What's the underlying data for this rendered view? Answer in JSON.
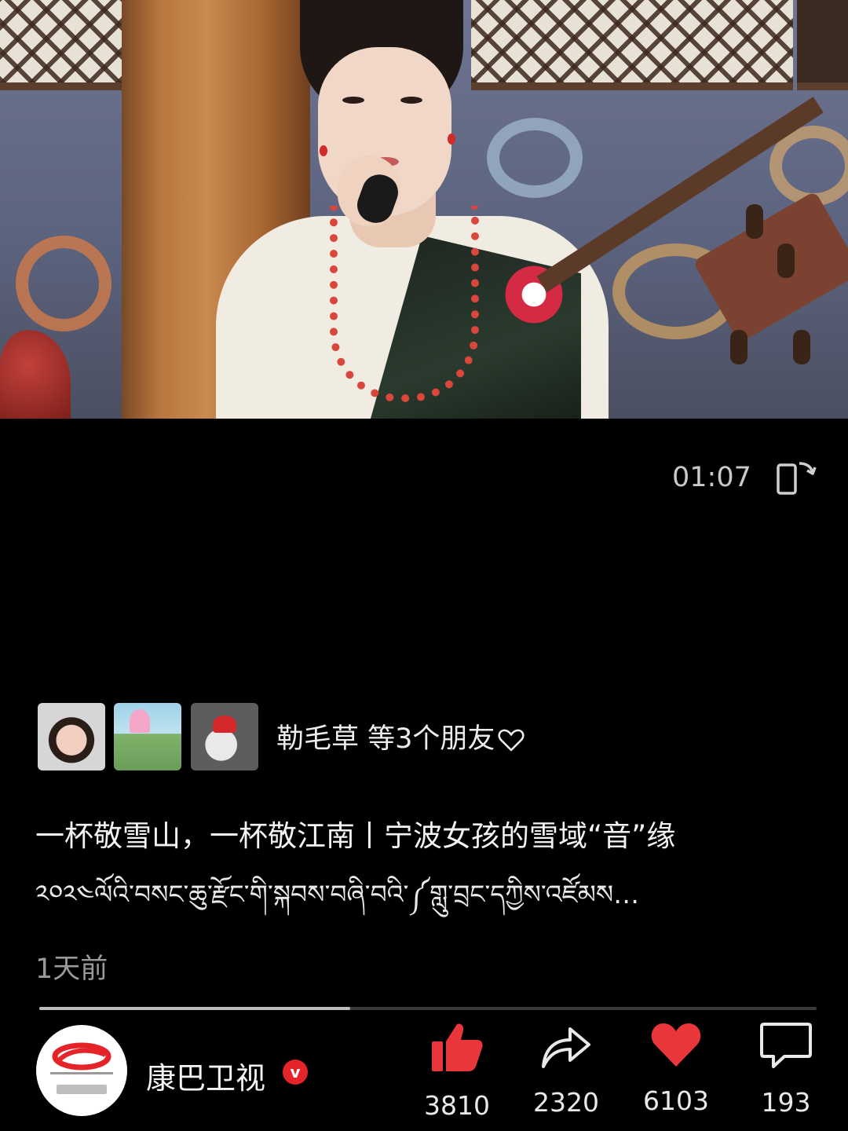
{
  "video": {
    "time": "01:07",
    "progress_fraction": 0.4
  },
  "friends": {
    "text": "勒毛草 等3个朋友"
  },
  "post": {
    "title": "一杯敬雪山，一杯敬江南丨宁波女孩的雪域“音”缘",
    "subtitle": "༢༠༢༤ལོའི་བསང་ཆུ་རྫོང་གི་སྐབས་བཞི་བའི་༼གླུ་བྲང་དཀྱིས་འཛོམས…",
    "date": "1天前"
  },
  "channel": {
    "name": "康巴卫视",
    "verified_mark": "v",
    "logo_text": "康巴卫视"
  },
  "actions": {
    "like_count": "3810",
    "share_count": "2320",
    "favorite_count": "6103",
    "comment_count": "193"
  },
  "colors": {
    "accent_red": "#e8363a",
    "background": "#000000"
  },
  "icons": [
    "rotate-screen-icon",
    "heart-outline-icon",
    "thumbs-up-icon",
    "share-icon",
    "heart-icon",
    "comment-icon",
    "verified-icon"
  ]
}
